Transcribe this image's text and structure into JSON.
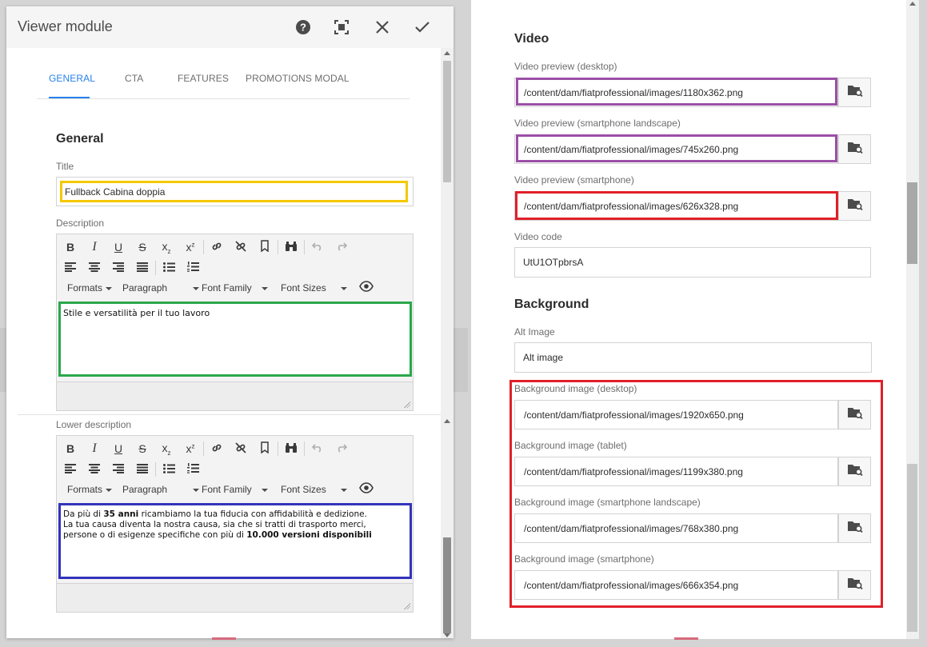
{
  "dialog": {
    "title": "Viewer module",
    "header_buttons": [
      {
        "name": "help-icon"
      },
      {
        "name": "fullscreen-icon"
      },
      {
        "name": "close-icon"
      },
      {
        "name": "checkmark-icon"
      }
    ],
    "tabs": [
      {
        "label": "GENERAL",
        "active": true
      },
      {
        "label": "CTA",
        "active": false
      },
      {
        "label": "FEATURES",
        "active": false
      },
      {
        "label": "PROMOTIONS MODAL",
        "active": false
      }
    ],
    "section_title": "General",
    "title_label": "Title",
    "title_value": "Fullback Cabina doppia",
    "description_label": "Description",
    "description_text": "Stile e versatilità per il tuo lavoro",
    "lower_description_label": "Lower description",
    "lower_description": {
      "p1_pre": "Da più di ",
      "p1_bold": "35 anni",
      "p1_post": " ricambiamo la tua fiducia con affidabilità e dedizione.",
      "p2": "La tua causa diventa la nostra causa, sia che si tratti di trasporto merci,",
      "p3_pre": "persone o di esigenze specifiche con più di ",
      "p3_bold": "10.000 versioni disponibili"
    },
    "rte_toolbar": {
      "bold": "B",
      "italic": "I",
      "underline": "U",
      "strike": "S",
      "subscript": "x",
      "superscript": "x",
      "sub_mark": "z",
      "sup_mark": "z",
      "formats": "Formats",
      "paragraph": "Paragraph",
      "font_family": "Font Family",
      "font_sizes": "Font Sizes"
    }
  },
  "right": {
    "video_section_title": "Video",
    "video_fields": [
      {
        "label": "Video preview (desktop)",
        "value": "/content/dam/fiatprofessional/images/1180x362.png"
      },
      {
        "label": "Video preview (smartphone landscape)",
        "value": "/content/dam/fiatprofessional/images/745x260.png"
      },
      {
        "label": "Video preview (smartphone)",
        "value": "/content/dam/fiatprofessional/images/626x328.png"
      }
    ],
    "video_code_label": "Video code",
    "video_code_value": "UtU1OTpbrsA",
    "background_section_title": "Background",
    "alt_image_label": "Alt Image",
    "alt_image_value": "Alt image",
    "background_fields": [
      {
        "label": "Background image (desktop)",
        "value": "/content/dam/fiatprofessional/images/1920x650.png"
      },
      {
        "label": "Background image (tablet)",
        "value": "/content/dam/fiatprofessional/images/1199x380.png"
      },
      {
        "label": "Background image (smartphone landscape)",
        "value": "/content/dam/fiatprofessional/images/768x380.png"
      },
      {
        "label": "Background image (smartphone)",
        "value": "/content/dam/fiatprofessional/images/666x354.png"
      }
    ]
  },
  "colors": {
    "accent": "#2680eb",
    "highlight_yellow": "#f5c800",
    "highlight_green": "#2aa84a",
    "highlight_blue": "#3333bb",
    "highlight_purple": "#9b4fa6",
    "highlight_red": "#e0202a"
  }
}
